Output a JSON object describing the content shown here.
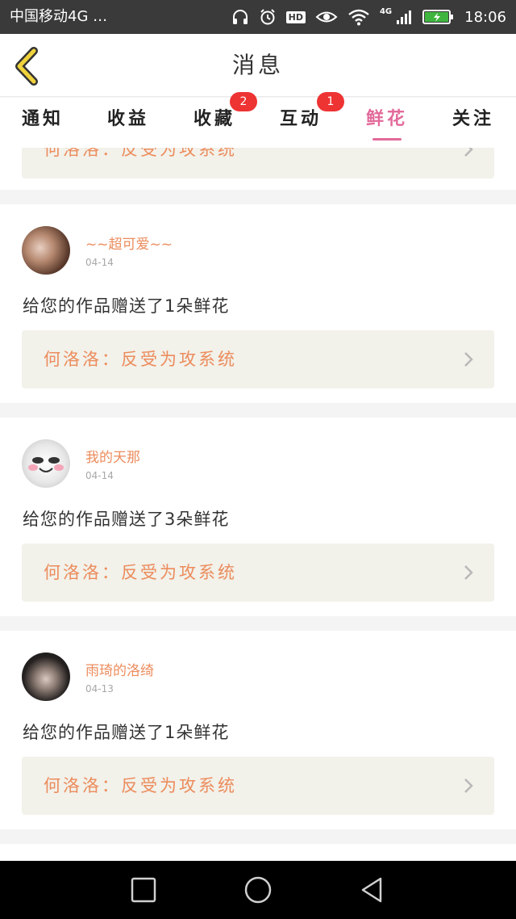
{
  "status_bar": {
    "carrier": "中国移动4G …",
    "hd": "HD",
    "network": "4G",
    "time": "18:06"
  },
  "header": {
    "title": "消息"
  },
  "tabs": [
    {
      "label": "通知",
      "badge": ""
    },
    {
      "label": "收益",
      "badge": ""
    },
    {
      "label": "收藏",
      "badge": "2"
    },
    {
      "label": "互动",
      "badge": "1"
    },
    {
      "label": "鲜花",
      "badge": "",
      "active": true
    },
    {
      "label": "关注",
      "badge": ""
    }
  ],
  "top_card": {
    "work": "何洛洛：反受为攻系统"
  },
  "items": [
    {
      "username": "~~超可爱~~",
      "date": "04-14",
      "message": "给您的作品赠送了1朵鲜花",
      "work": "何洛洛：反受为攻系统"
    },
    {
      "username": "我的天那",
      "date": "04-14",
      "message": "给您的作品赠送了3朵鲜花",
      "work": "何洛洛：反受为攻系统"
    },
    {
      "username": "雨琦的洛绮",
      "date": "04-13",
      "message": "给您的作品赠送了1朵鲜花",
      "work": "何洛洛：反受为攻系统"
    }
  ],
  "colors": {
    "accent_pink": "#e26a9a",
    "accent_orange": "#ec8c5c",
    "badge_red": "#ee3333"
  }
}
